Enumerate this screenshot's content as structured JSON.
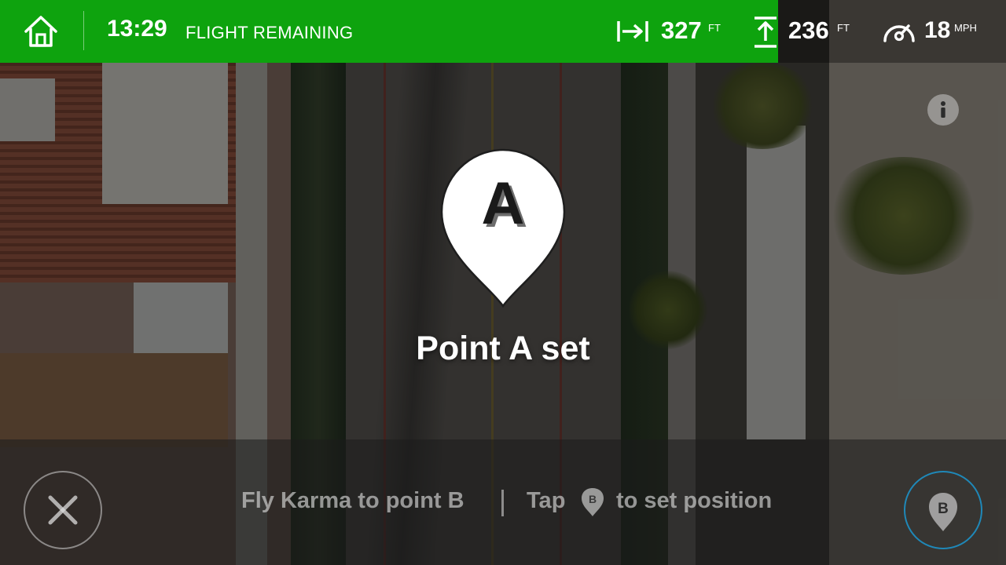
{
  "topbar": {
    "flight_time": "13:29",
    "flight_label": "FLIGHT REMAINING",
    "distance": {
      "value": "327",
      "unit": "FT"
    },
    "altitude": {
      "value": "236",
      "unit": "FT"
    },
    "speed": {
      "value": "18",
      "unit": "MPH"
    }
  },
  "main": {
    "pin_letter": "A",
    "status": "Point A set"
  },
  "bottom": {
    "instruction": "Fly Karma to point B",
    "tap_prefix": "Tap",
    "tap_suffix": "to set position",
    "b_letter": "B"
  },
  "icons": {
    "home": "home-icon",
    "distance": "horizontal-distance-icon",
    "altitude": "altitude-icon",
    "speed": "speedometer-icon",
    "info": "info-icon",
    "cancel": "close-icon",
    "set_b": "map-pin-b-icon"
  },
  "colors": {
    "topbar_green": "#0ea30e",
    "setb_ring": "#1f88b8"
  }
}
